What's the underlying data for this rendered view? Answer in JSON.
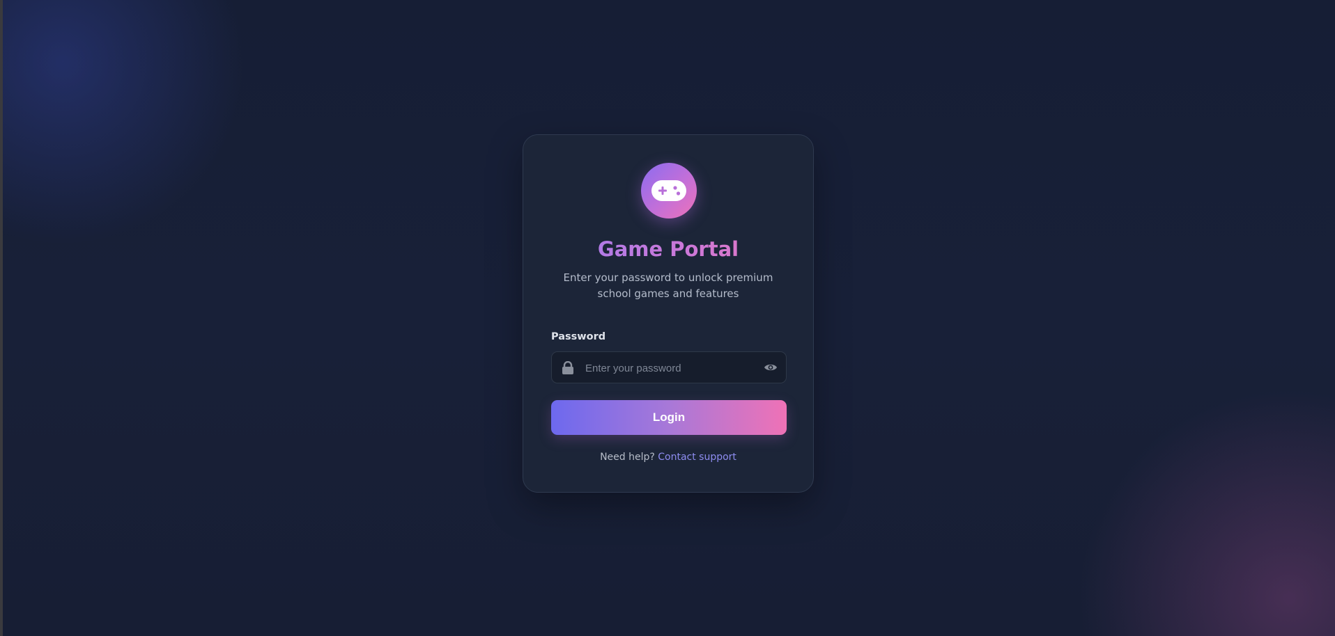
{
  "app": {
    "title": "Game Portal",
    "subtitle": "Enter your password to unlock premium school games and features"
  },
  "form": {
    "password_label": "Password",
    "password_placeholder": "Enter your password",
    "password_value": "",
    "login_label": "Login"
  },
  "help": {
    "prompt": "Need help?",
    "link_label": "Contact support"
  },
  "icons": {
    "logo": "gamepad-icon",
    "field": "lock-icon",
    "toggle": "eye-icon"
  },
  "colors": {
    "background": "#151d33",
    "card": "#1c2538",
    "accent_start": "#6d69ee",
    "accent_end": "#ef72b6",
    "link": "#8e8cf0"
  }
}
